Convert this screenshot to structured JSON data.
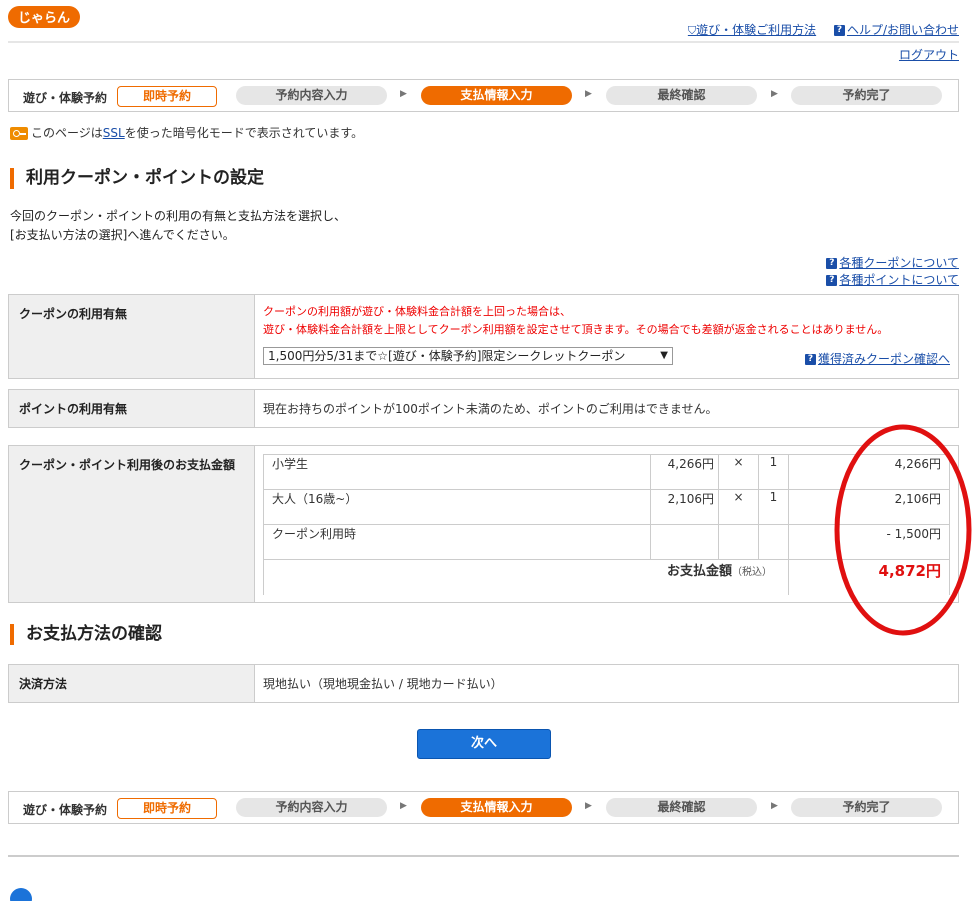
{
  "header": {
    "logo_text": "じゃらん",
    "links": [
      "遊び・体験ご利用方法",
      "ヘルプ/お問い合わせ"
    ],
    "logout": "ログアウト"
  },
  "steps": {
    "label": "遊び・体験予約",
    "badge": "即時予約",
    "items": [
      "予約内容入力",
      "支払情報入力",
      "最終確認",
      "予約完了"
    ],
    "active_index": 1
  },
  "ssl": {
    "prefix": "このページは",
    "link": "SSL",
    "suffix": "を使った暗号化モードで表示されています。"
  },
  "coupon_section": {
    "title": "利用クーポン・ポイントの設定",
    "intro_line1": "今回のクーポン・ポイントの利用の有無と支払方法を選択し、",
    "intro_line2": "[お支払い方法の選択]へ進んでください。",
    "help_links": [
      "各種クーポンについて",
      "各種ポイントについて"
    ]
  },
  "coupon_row": {
    "header": "クーポンの利用有無",
    "note_line1": "クーポンの利用額が遊び・体験料金合計額を上回った場合は、",
    "note_line2": "遊び・体験料金合計額を上限としてクーポン利用額を設定させて頂きます。その場合でも差額が返金されることはありません。",
    "select_value": "1,500円分5/31まで☆[遊び・体験予約]限定シークレットクーポン",
    "confirm_link": "獲得済みクーポン確認へ"
  },
  "point_row": {
    "header": "ポイントの利用有無",
    "text": "現在お持ちのポイントが100ポイント未満のため、ポイントのご利用はできません。"
  },
  "payment_row": {
    "header": "クーポン・ポイント利用後のお支払金額",
    "items": [
      {
        "name": "小学生",
        "unit": "4,266円",
        "times": "×",
        "qty": "1",
        "total": "4,266円"
      },
      {
        "name": "大人（16歳~）",
        "unit": "2,106円",
        "times": "×",
        "qty": "1",
        "total": "2,106円"
      },
      {
        "name": "クーポン利用時",
        "unit": "",
        "times": "",
        "qty": "",
        "total": "- 1,500円"
      }
    ],
    "total_label": "お支払金額",
    "total_tax": "（税込）",
    "total_value": "4,872円"
  },
  "method_section": {
    "title": "お支払方法の確認",
    "header": "決済方法",
    "value": "現地払い（現地現金払い / 現地カード払い）"
  },
  "next_button": "次へ",
  "colors": {
    "accent": "#ef6b00",
    "link": "#1a4ea8",
    "button": "#1b73d9",
    "highlight_red": "#e01010"
  }
}
